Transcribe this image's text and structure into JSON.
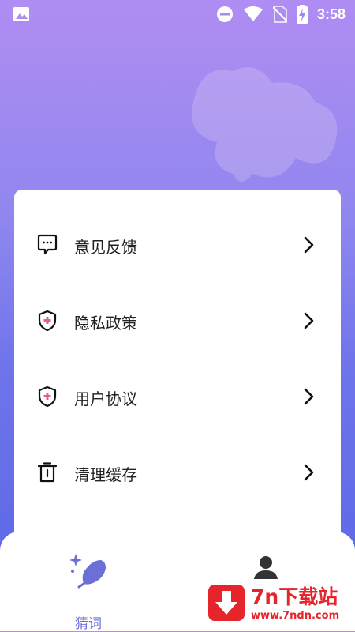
{
  "status_bar": {
    "time": "3:58",
    "icons": [
      "image-icon",
      "dnd-icon",
      "wifi-icon",
      "no-sim-icon",
      "battery-charging-icon"
    ]
  },
  "menu": {
    "items": [
      {
        "label": "意见反馈",
        "icon": "feedback-icon"
      },
      {
        "label": "隐私政策",
        "icon": "privacy-shield-icon"
      },
      {
        "label": "用户协议",
        "icon": "agreement-shield-icon"
      },
      {
        "label": "清理缓存",
        "icon": "trash-icon"
      }
    ]
  },
  "bottom_nav": {
    "tabs": [
      {
        "label": "猜词",
        "icon": "guess-word-icon",
        "active": true
      },
      {
        "label": "",
        "icon": "profile-icon",
        "active": false
      }
    ]
  },
  "watermark": {
    "title": "7n下载站",
    "url": "www.7ndn.com"
  },
  "colors": {
    "accent": "#6b6fd6",
    "shield_cross": "#e9579a",
    "watermark_red": "#e5242b"
  }
}
